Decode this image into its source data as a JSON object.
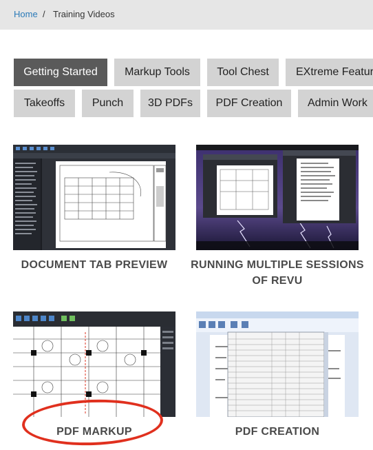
{
  "breadcrumb": {
    "home": "Home",
    "separator": "/",
    "current": "Training Videos"
  },
  "tabs": [
    {
      "label": "Getting Started",
      "active": true
    },
    {
      "label": "Markup Tools",
      "active": false
    },
    {
      "label": "Tool Chest",
      "active": false
    },
    {
      "label": "EXtreme Features",
      "active": false
    },
    {
      "label": "Takeoffs",
      "active": false
    },
    {
      "label": "Punch",
      "active": false
    },
    {
      "label": "3D PDFs",
      "active": false
    },
    {
      "label": "PDF Creation",
      "active": false
    },
    {
      "label": "Admin Work",
      "active": false
    }
  ],
  "videos": [
    {
      "title": "DOCUMENT TAB PREVIEW"
    },
    {
      "title": "RUNNING MULTIPLE SESSIONS OF REVU"
    },
    {
      "title": "PDF MARKUP"
    },
    {
      "title": "PDF CREATION"
    }
  ],
  "colors": {
    "active_tab": "#5a5a5a",
    "tab": "#d3d3d3",
    "link": "#2a7ab8",
    "highlight_circle": "#e0301e"
  }
}
